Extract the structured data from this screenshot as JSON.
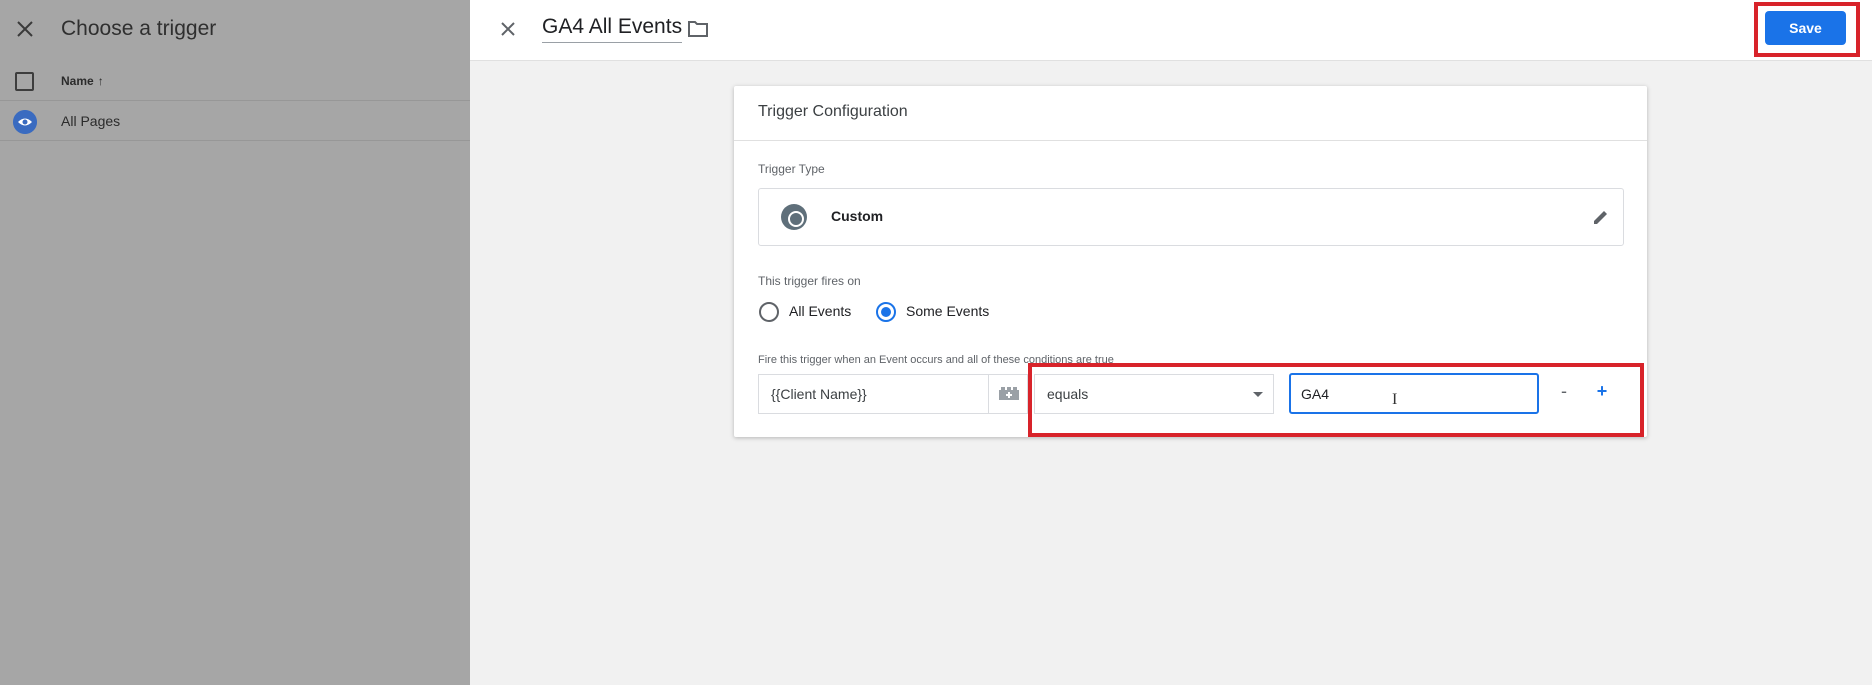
{
  "left_panel": {
    "title": "Choose a trigger",
    "column_name": "Name",
    "rows": [
      {
        "label": "All Pages"
      }
    ]
  },
  "header": {
    "tag_name": "GA4 All Events",
    "save_label": "Save"
  },
  "card": {
    "title": "Trigger Configuration",
    "trigger_type_label": "Trigger Type",
    "trigger_type_value": "Custom",
    "fires_on_label": "This trigger fires on",
    "fires_on_options": [
      {
        "label": "All Events",
        "selected": false
      },
      {
        "label": "Some Events",
        "selected": true
      }
    ],
    "condition_intro": "Fire this trigger when an Event occurs and all of these conditions are true",
    "condition": {
      "variable": "{{Client Name}}",
      "operator": "equals",
      "value": "GA4"
    },
    "remove_label": "-",
    "add_label": "+"
  },
  "colors": {
    "accent": "#1a73e8",
    "highlight": "#d8232a"
  }
}
